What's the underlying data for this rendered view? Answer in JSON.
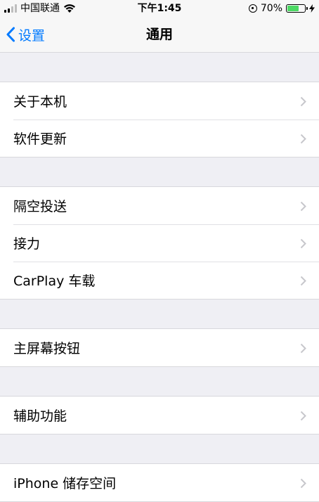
{
  "status_bar": {
    "carrier": "中国联通",
    "time": "下午1:45",
    "battery_percent": "70%",
    "battery_level": 0.7,
    "icons": [
      "signal-icon",
      "wifi-icon",
      "rotation-lock-icon",
      "battery-icon",
      "charging-icon"
    ]
  },
  "nav": {
    "back_label": "设置",
    "title": "通用"
  },
  "groups": [
    {
      "items": [
        {
          "label": "关于本机"
        },
        {
          "label": "软件更新"
        }
      ]
    },
    {
      "items": [
        {
          "label": "隔空投送"
        },
        {
          "label": "接力"
        },
        {
          "label": "CarPlay 车载"
        }
      ]
    },
    {
      "items": [
        {
          "label": "主屏幕按钮"
        }
      ]
    },
    {
      "items": [
        {
          "label": "辅助功能"
        }
      ]
    },
    {
      "items": [
        {
          "label": "iPhone 储存空间"
        }
      ]
    }
  ],
  "colors": {
    "accent": "#007aff",
    "background": "#efeff4",
    "battery_fill": "#4cd964"
  }
}
